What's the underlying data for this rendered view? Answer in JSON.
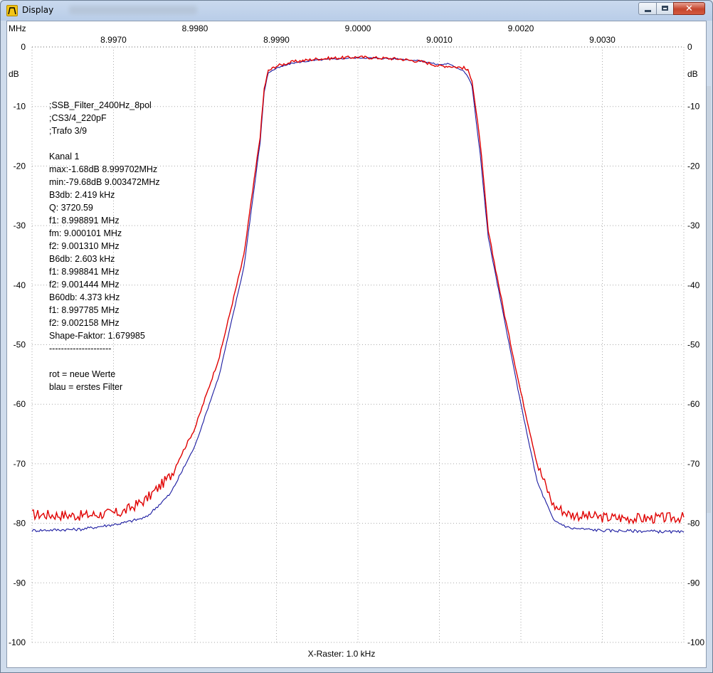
{
  "window": {
    "title": "Display"
  },
  "chart_data": {
    "type": "line",
    "x_unit_label": "MHz",
    "y_unit_label": "dB",
    "xlim": [
      8.996,
      9.004
    ],
    "ylim": [
      -100,
      0
    ],
    "x_ticks": [
      "8.9970",
      "8.9980",
      "8.9990",
      "9.0000",
      "9.0010",
      "9.0020",
      "9.0030"
    ],
    "y_ticks": [
      "0",
      "-10",
      "-20",
      "-30",
      "-40",
      "-50",
      "-60",
      "-70",
      "-80",
      "-90",
      "-100"
    ],
    "grid": true,
    "footer": "X-Raster: 1.0 kHz",
    "annotation_lines": [
      ";SSB_Filter_2400Hz_8pol",
      ";CS3/4_220pF",
      ";Trafo 3/9",
      "",
      "Kanal 1",
      "max:-1.68dB 8.999702MHz",
      "min:-79.68dB 9.003472MHz",
      "B3db: 2.419 kHz",
      "Q: 3720.59",
      "f1: 8.998891 MHz",
      "fm: 9.000101 MHz",
      "f2: 9.001310 MHz",
      "B6db: 2.603 kHz",
      "f1: 8.998841 MHz",
      "f2: 9.001444 MHz",
      "B60db: 4.373 kHz",
      "f1: 8.997785 MHz",
      "f2: 9.002158 MHz",
      "Shape-Faktor: 1.679985",
      "---------------------",
      "",
      "rot = neue Werte",
      "blau = erstes Filter"
    ],
    "series": [
      {
        "color": "#e00000",
        "x": [
          8.996,
          8.9966,
          8.9971,
          8.9974,
          8.9977,
          8.998,
          8.9983,
          8.9986,
          8.9988,
          8.99885,
          8.9989,
          8.999,
          8.9992,
          8.9995,
          9.0,
          9.0005,
          9.0008,
          9.001,
          9.0011,
          9.0013,
          9.00135,
          9.0014,
          9.0015,
          9.0016,
          9.0018,
          9.002,
          9.0022,
          9.0024,
          9.0026,
          9.0028,
          9.003,
          9.0035,
          9.004
        ],
        "y": [
          -78.5,
          -78.7,
          -78.2,
          -76.0,
          -72.0,
          -64.0,
          -52.0,
          -35.0,
          -15.0,
          -7.0,
          -4.0,
          -3.2,
          -2.5,
          -2.0,
          -1.7,
          -2.0,
          -2.5,
          -3.2,
          -3.2,
          -3.5,
          -4.0,
          -5.5,
          -16.0,
          -31.0,
          -45.0,
          -58.0,
          -70.0,
          -77.0,
          -78.5,
          -78.8,
          -79.0,
          -79.2,
          -79.0
        ]
      },
      {
        "color": "#1a1aa0",
        "x": [
          8.996,
          8.9966,
          8.9971,
          8.9974,
          8.9977,
          8.998,
          8.9983,
          8.9986,
          8.9988,
          8.99885,
          8.9989,
          8.999,
          8.9992,
          8.9995,
          9.0,
          9.0005,
          9.0008,
          9.001,
          9.0011,
          9.0013,
          9.00135,
          9.0014,
          9.0015,
          9.0016,
          9.0018,
          9.002,
          9.0022,
          9.0024,
          9.0026,
          9.0028,
          9.003,
          9.0035,
          9.004
        ],
        "y": [
          -81.2,
          -81.0,
          -80.0,
          -79.0,
          -75.0,
          -67.0,
          -55.0,
          -37.0,
          -16.0,
          -7.5,
          -4.3,
          -3.6,
          -2.7,
          -2.2,
          -1.8,
          -2.0,
          -2.4,
          -3.0,
          -2.8,
          -4.0,
          -5.0,
          -6.5,
          -18.0,
          -32.0,
          -46.0,
          -60.0,
          -73.0,
          -79.5,
          -80.8,
          -81.0,
          -81.2,
          -81.3,
          -81.5
        ]
      }
    ]
  }
}
